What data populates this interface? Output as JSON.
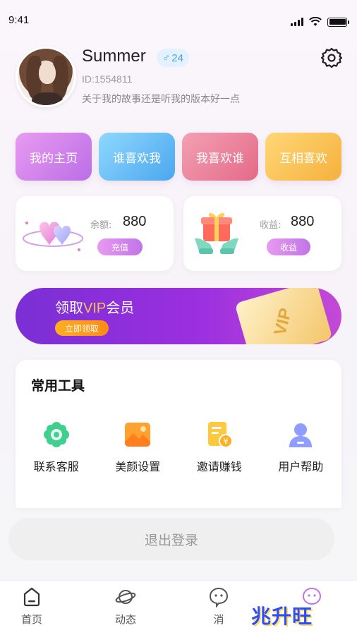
{
  "status_bar": {
    "time": "9:41"
  },
  "profile": {
    "name": "Summer",
    "gender_symbol": "♂",
    "age": "24",
    "id": "ID:1554811",
    "bio": "关于我的故事还是听我的版本好一点"
  },
  "quick_actions": [
    {
      "label": "我的主页"
    },
    {
      "label": "谁喜欢我"
    },
    {
      "label": "我喜欢谁"
    },
    {
      "label": "互相喜欢"
    }
  ],
  "wallet": {
    "balance_label": "余额:",
    "balance_value": "880",
    "recharge_label": "充值",
    "earnings_label": "收益:",
    "earnings_value": "880",
    "earnings_button": "收益"
  },
  "vip_banner": {
    "title_prefix": "领取",
    "title_vip": "VIP",
    "title_suffix": "会员",
    "cta": "立即领取",
    "card_text": "VIP"
  },
  "tools": {
    "title": "常用工具",
    "items": [
      {
        "label": "联系客服",
        "icon": "flower-service-icon"
      },
      {
        "label": "美颜设置",
        "icon": "image-icon"
      },
      {
        "label": "邀请赚钱",
        "icon": "receipt-yuan-icon"
      },
      {
        "label": "用户帮助",
        "icon": "user-icon"
      }
    ]
  },
  "logout": {
    "label": "退出登录"
  },
  "tabbar": {
    "items": [
      {
        "label": "首页",
        "icon": "home-icon"
      },
      {
        "label": "动态",
        "icon": "planet-icon"
      },
      {
        "label": "消",
        "icon": "chat-icon"
      },
      {
        "label": "",
        "icon": "profile-icon"
      }
    ]
  },
  "watermark": {
    "text": "兆升旺"
  },
  "colors": {
    "accent_purple": "#c174e8",
    "vip_gold": "#f2c64e",
    "cta_orange": "#ff8a14",
    "badge_blue": "#4aa2f2"
  }
}
